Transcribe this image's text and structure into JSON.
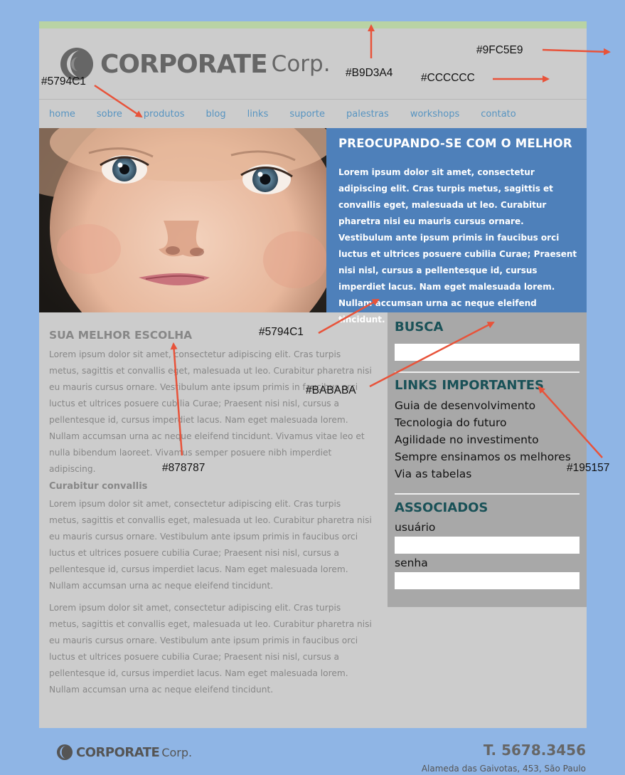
{
  "brand": {
    "bold": "CORPORATE",
    "light": "Corp."
  },
  "nav": [
    "home",
    "sobre",
    "produtos",
    "blog",
    "links",
    "suporte",
    "palestras",
    "workshops",
    "contato"
  ],
  "hero": {
    "title": "PREOCUPANDO-SE COM O MELHOR",
    "text": "Lorem ipsum dolor sit amet, consectetur adipiscing elit. Cras turpis metus, sagittis et convallis eget, malesuada ut leo. Curabitur pharetra nisi eu mauris cursus ornare. Vestibulum ante ipsum primis in faucibus orci luctus et ultrices posuere cubilia Curae; Praesent nisi nisl, cursus a pellentesque id, cursus imperdiet lacus. Nam eget malesuada lorem. Nullam accumsan urna ac neque eleifend tincidunt."
  },
  "main": {
    "heading": "SUA MELHOR ESCOLHA",
    "p1": "Lorem ipsum dolor sit amet, consectetur adipiscing elit. Cras turpis metus, sagittis et convallis eget, malesuada ut leo. Curabitur pharetra nisi eu mauris cursus ornare. Vestibulum ante ipsum primis in faucibus orci luctus et ultrices posuere cubilia Curae; Praesent nisi nisl, cursus a pellentesque id, cursus imperdiet lacus. Nam eget malesuada lorem. Nullam accumsan urna ac neque eleifend tincidunt. Vivamus vitae leo et nulla bibendum laoreet. Vivamus semper posuere nibh imperdiet adipiscing.",
    "subheading": "Curabitur convallis",
    "p2": "Lorem ipsum dolor sit amet, consectetur adipiscing elit. Cras turpis metus, sagittis et convallis eget, malesuada ut leo. Curabitur pharetra nisi eu mauris cursus ornare. Vestibulum ante ipsum primis in faucibus orci luctus et ultrices posuere cubilia Curae; Praesent nisi nisl, cursus a pellentesque id, cursus imperdiet lacus. Nam eget malesuada lorem. Nullam accumsan urna ac neque eleifend tincidunt.",
    "p3": "Lorem ipsum dolor sit amet, consectetur adipiscing elit. Cras turpis metus, sagittis et convallis eget, malesuada ut leo. Curabitur pharetra nisi eu mauris cursus ornare. Vestibulum ante ipsum primis in faucibus orci luctus et ultrices posuere cubilia Curae; Praesent nisi nisl, cursus a pellentesque id, cursus imperdiet lacus. Nam eget malesuada lorem. Nullam accumsan urna ac neque eleifend tincidunt."
  },
  "sidebar": {
    "search_title": "BUSCA",
    "links_title": "LINKS IMPORTANTES",
    "links": [
      "Guia de desenvolvimento",
      "Tecnologia do futuro",
      "Agilidade no investimento",
      "Sempre ensinamos os melhores",
      "Via as tabelas"
    ],
    "assoc_title": "ASSOCIADOS",
    "user_label": "usuário",
    "pass_label": "senha"
  },
  "annotations": {
    "green": "#B9D3A4",
    "bg_blue": "#9FC5E9",
    "gray_panel": "#CCCCCC",
    "link_blue_nav": "#5794C1",
    "link_blue_hero": "#5794C1",
    "sidebar_gray": "#BABABA",
    "text_gray": "#878787",
    "dark_teal": "#195157"
  },
  "footer": {
    "brand_bold": "CORPORATE",
    "brand_light": "Corp.",
    "phone": "T. 5678.3456",
    "address": "Alameda das Gaivotas, 453, São Paulo"
  },
  "colors": {
    "page_bg": "#8FB5E5",
    "panel": "#CCCCCC",
    "top_bar": "#B9D3A4",
    "nav_link": "#5794C1",
    "hero_panel": "#4E80BA",
    "sidebar": "#A8A8A8",
    "body_text": "#878787",
    "sidebar_title": "#195157",
    "annotation_arrow": "#E8533A"
  }
}
